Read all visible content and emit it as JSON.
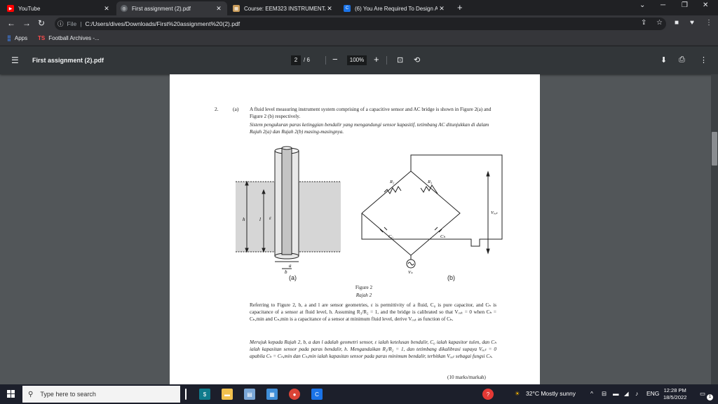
{
  "tabs": [
    {
      "label": "YouTube",
      "icon": "youtube-icon",
      "color": "#ff0000"
    },
    {
      "label": "First assignment (2).pdf",
      "icon": "globe-icon",
      "color": "#5f6368"
    },
    {
      "label": "Course: EEM323 INSTRUMENTAT",
      "icon": "course-icon",
      "color": "#c89b5a"
    },
    {
      "label": "(6) You Are Required To Design A",
      "icon": "chegg-icon",
      "color": "#1a73e8"
    }
  ],
  "address": {
    "prefix": "File",
    "url": "C:/Users/dives/Downloads/First%20assignment%20(2).pdf"
  },
  "bookmarks": [
    {
      "label": "Apps",
      "icon": "apps-grid-icon"
    },
    {
      "label": "Football Archives -...",
      "icon": "ts-icon",
      "badge": "TS"
    }
  ],
  "pdf": {
    "title": "First assignment (2).pdf",
    "page_current": "2",
    "page_total": "/ 6",
    "zoom": "100%"
  },
  "document": {
    "qnum": "2.",
    "qpart": "(a)",
    "para1": "A fluid level measuring instrument system comprising of a capacitive sensor and AC bridge is shown in Figure 2(a) and Figure 2 (b) respectively.",
    "para1_ms": "Sistem pengukuran paras ketinggian bendalir yang mengandungi sensor kapasitif, tetimbang AC ditunjukkan di dalam Rajah 2(a) dan Rajah 2(b) masing-masingnya.",
    "fig_a": "(a)",
    "fig_b": "(b)",
    "caption": "Figure 2",
    "caption_ms": "Rajah 2",
    "para2": "Referring to Figure 2, b, a and l are sensor geometries, ε is permittivity of a fluid, C₀ is pure capacitor, and Cₕ is capacitance of a sensor at fluid level, h. Assuming R₃/R₂ = 1, and the bridge is calibrated so that Vₒᵤₜ = 0 when Cₕ = Cₕ,min and Cₕ,min is a capacitance of a sensor at minimum fluid level, derive Vₒᵤₜ as function of Cₕ.",
    "para2_ms": "Merujuk kepada Rajah 2, b, a dan l adalah geometri sensor, ε ialah ketelusan bendalir, C₀ ialah kapasitor tulen, dan Cₕ ialah kapasitan sensor pada paras bendalir, h. Mengandaikan R₃/R₂ = 1, dan tetimbang dikalibrasi supaya Vₒᵤₜ = 0 apabila Cₕ = Cₕ,min dan Cₕ,min ialah kapasitan sensor pada paras minimum bendalir, terbitkan Vₒᵤₜ sebagai fungsi Cₕ.",
    "marks": "(10 marks/markah)",
    "labels": {
      "R2": "R₂",
      "R3": "R₃",
      "C0": "C₀",
      "Ch": "Cₕ",
      "Vout": "Vₒᵤₜ",
      "Vs": "Vₛ",
      "h": "h",
      "l": "l",
      "eps": "ε",
      "a": "a",
      "b": "b"
    }
  },
  "taskbar": {
    "search_placeholder": "Type here to search",
    "weather": "32°C  Mostly sunny",
    "lang": "ENG",
    "time": "12:28 PM",
    "date": "18/5/2022",
    "notif_count": "1"
  }
}
